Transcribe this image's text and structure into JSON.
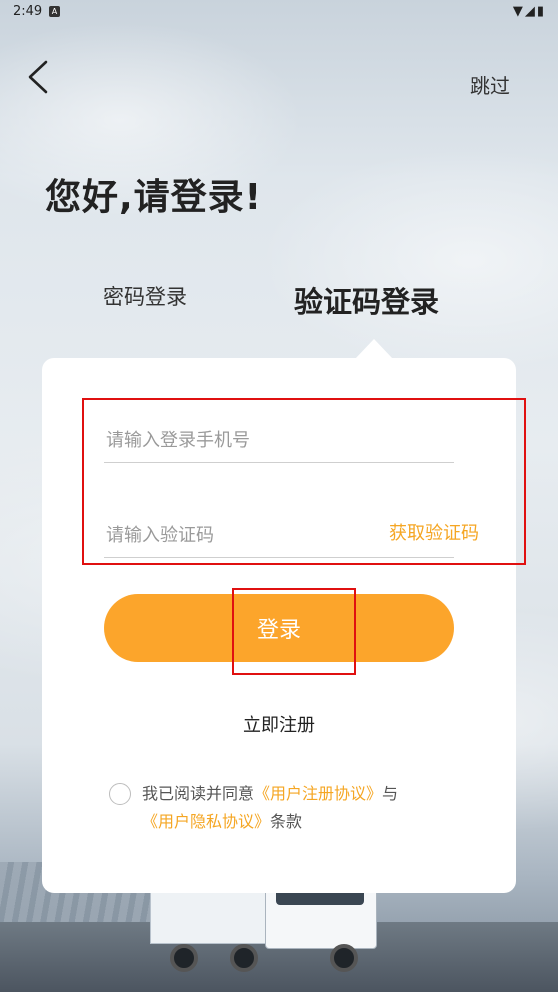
{
  "status_bar": {
    "time": "2:49",
    "notif_icon": "A",
    "icons": "▼◢▮"
  },
  "header": {
    "skip_label": "跳过"
  },
  "page": {
    "title": "您好,请登录!"
  },
  "tabs": [
    {
      "label": "密码登录",
      "active": false
    },
    {
      "label": "验证码登录",
      "active": true
    }
  ],
  "form": {
    "phone_placeholder": "请输入登录手机号",
    "phone_value": "",
    "code_placeholder": "请输入验证码",
    "code_value": "",
    "get_code_label": "获取验证码",
    "login_label": "登录",
    "register_label": "立即注册"
  },
  "agreement": {
    "prefix": "我已阅读并同意",
    "user_agreement": "《用户注册协议》",
    "conjunction": "与",
    "privacy_policy": "《用户隐私协议》",
    "suffix": "条款",
    "checked": false
  },
  "colors": {
    "accent": "#fca52b",
    "link": "#f5a623",
    "annotation": "#e01010"
  }
}
